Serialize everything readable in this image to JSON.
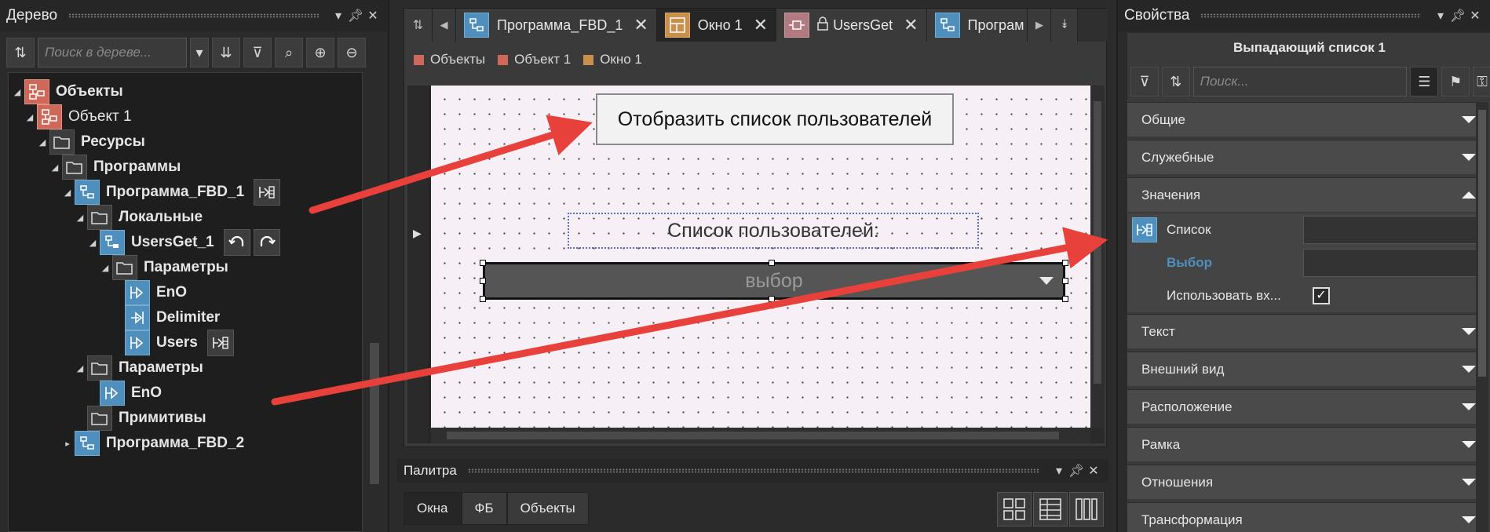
{
  "tree_panel": {
    "title": "Дерево",
    "search_placeholder": "Поиск в дереве...",
    "items": [
      {
        "label": "Объекты",
        "icon": "objects-icon"
      },
      {
        "label": "Объект 1",
        "icon": "object-icon"
      },
      {
        "label": "Ресурсы",
        "icon": "folder-icon"
      },
      {
        "label": "Программы",
        "icon": "folder-icon"
      },
      {
        "label": "Программа_FBD_1",
        "icon": "fbd-program-icon"
      },
      {
        "label": "Локальные",
        "icon": "folder-icon"
      },
      {
        "label": "UsersGet_1",
        "icon": "function-block-icon"
      },
      {
        "label": "Параметры",
        "icon": "folder-icon"
      },
      {
        "label": "EnO",
        "icon": "output-pin-icon"
      },
      {
        "label": "Delimiter",
        "icon": "input-pin-icon"
      },
      {
        "label": "Users",
        "icon": "output-pin-icon"
      },
      {
        "label": "Параметры",
        "icon": "folder-icon"
      },
      {
        "label": "EnO",
        "icon": "output-pin-icon"
      },
      {
        "label": "Примитивы",
        "icon": "folder-icon"
      },
      {
        "label": "Программа_FBD_2",
        "icon": "fbd-program-icon"
      }
    ]
  },
  "editor": {
    "tabs": [
      {
        "label": "Программа_FBD_1",
        "icon": "fbd-program-icon",
        "active": false
      },
      {
        "label": "Окно 1",
        "icon": "window-icon",
        "active": true
      },
      {
        "label": "UsersGet",
        "icon": "lock-icon",
        "active": false
      },
      {
        "label": "Програм",
        "icon": "fbd-program-icon",
        "active": false
      }
    ],
    "breadcrumb": [
      {
        "label": "Объекты",
        "color": "#d0685a"
      },
      {
        "label": "Объект 1",
        "color": "#d0685a"
      },
      {
        "label": "Окно 1",
        "color": "#c8904a"
      }
    ],
    "canvas": {
      "button_text": "Отобразить список пользователей",
      "label_text": "Список пользователей:",
      "combo_placeholder": "выбор"
    }
  },
  "palette": {
    "title": "Палитра",
    "tabs": [
      "Окна",
      "ФБ",
      "Объекты"
    ]
  },
  "properties": {
    "title": "Свойства",
    "element_title": "Выпадающий список 1",
    "search_placeholder": "Поиск...",
    "sections": {
      "general": "Общие",
      "service": "Служебные",
      "values": "Значения",
      "text": "Текст",
      "appearance": "Внешний вид",
      "position": "Расположение",
      "frame": "Рамка",
      "relations": "Отношения",
      "transform": "Трансформация"
    },
    "value_rows": {
      "list": "Список",
      "selection": "Выбор",
      "use_input": "Использовать вх..."
    },
    "use_input_checked": true
  },
  "colors": {
    "accent_blue": "#4f8fbd",
    "object_red": "#d0685a",
    "window_orange": "#c8904a",
    "annotation_arrow": "#e8413c"
  }
}
